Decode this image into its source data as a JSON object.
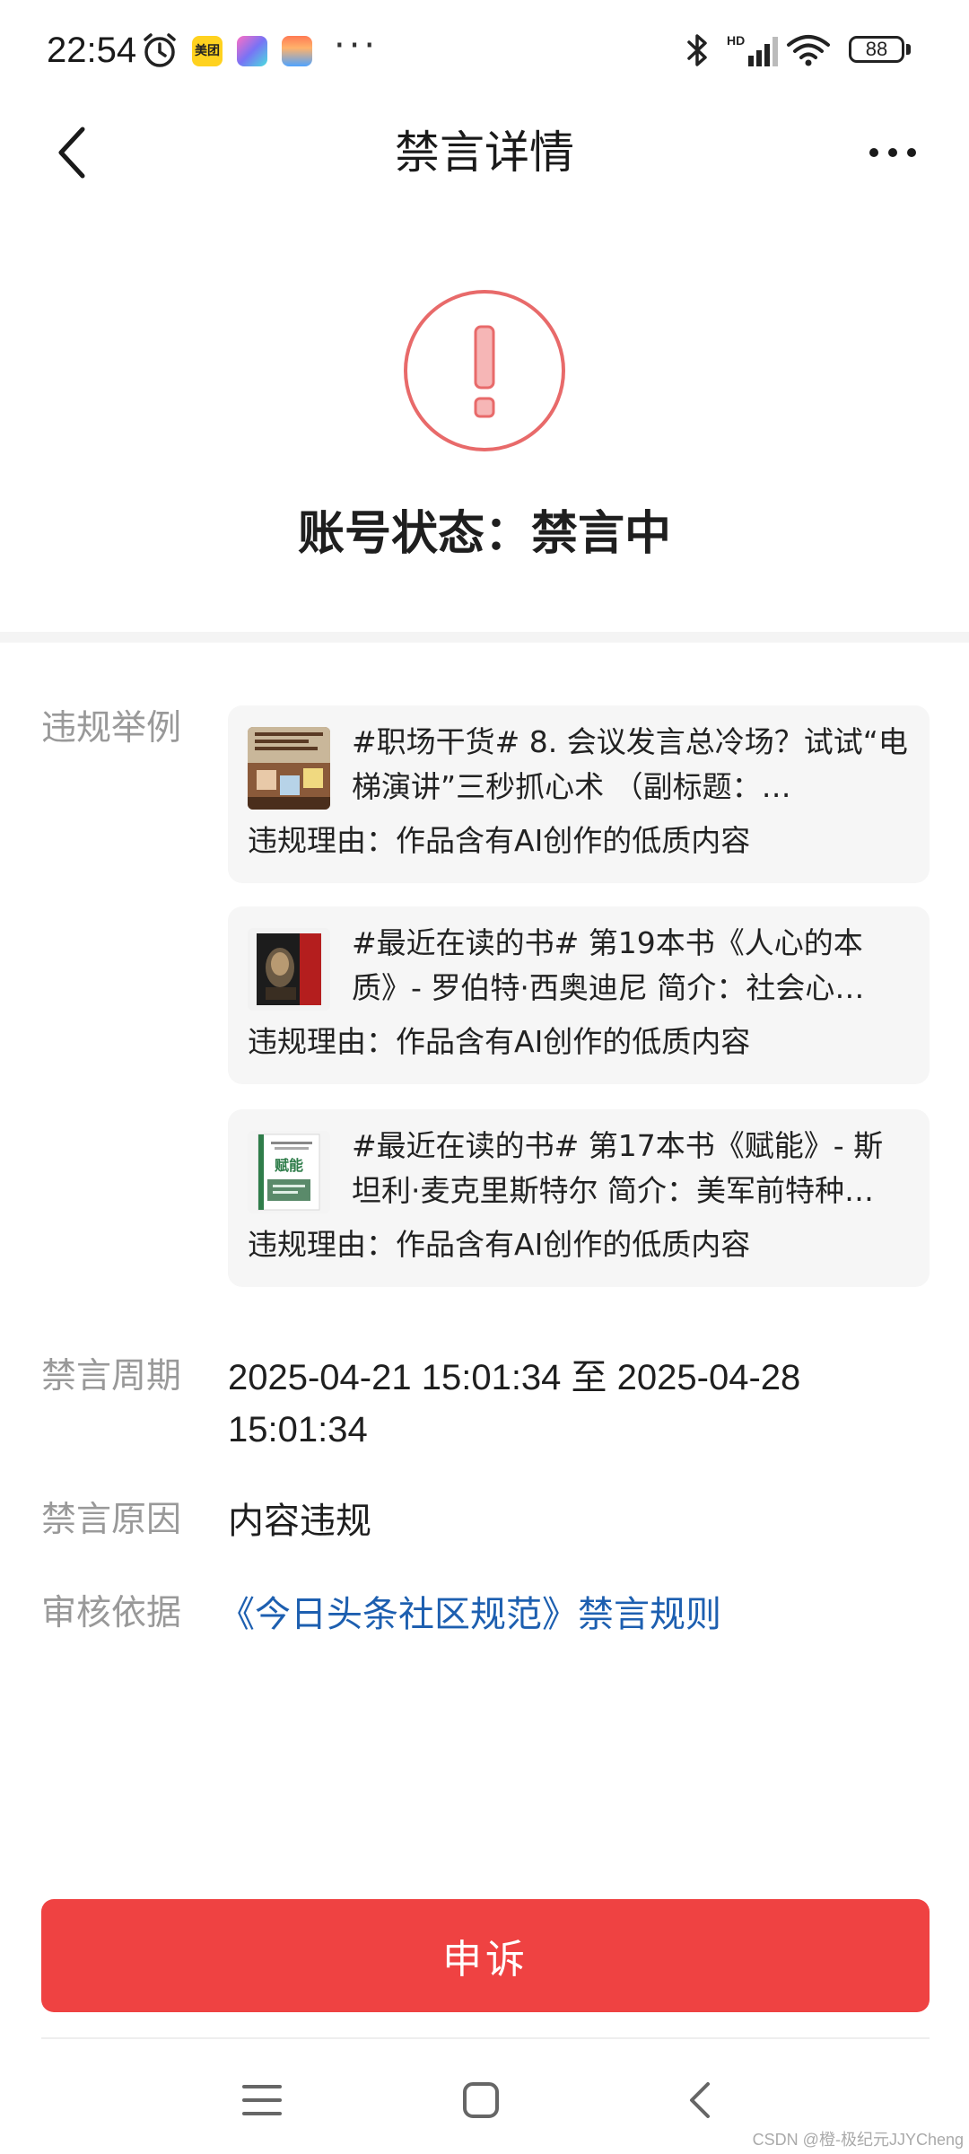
{
  "status_bar": {
    "time": "22:54",
    "meituan_label": "美团",
    "overflow": "···",
    "network_label": "HD",
    "battery": "88",
    "icons": [
      "alarm-icon",
      "meituan-app-icon",
      "shortcut-app-icon",
      "wallet-app-icon",
      "bluetooth-icon",
      "signal-icon",
      "wifi-icon",
      "battery-icon"
    ]
  },
  "nav": {
    "title": "禁言详情",
    "back_icon": "chevron-left-icon",
    "more_icon": "more-horizontal-icon"
  },
  "status": {
    "icon": "exclamation-circle-icon",
    "text": "账号状态：禁言中",
    "accent_color": "#e86a6a"
  },
  "violations": {
    "label": "违规举例",
    "items": [
      {
        "title": "#职场干货# 8. 会议发言总冷场？试试“电梯演讲”三秒抓心术 （副标题：…",
        "reason": "违规理由：作品含有AI创作的低质内容",
        "thumb_icon": "article-thumbnail"
      },
      {
        "title": "#最近在读的书# 第19本书《人心的本质》- 罗伯特·西奥迪尼 简介：社会心…",
        "reason": "违规理由：作品含有AI创作的低质内容",
        "thumb_icon": "book-cover-thumbnail"
      },
      {
        "title": "#最近在读的书# 第17本书《赋能》- 斯坦利·麦克里斯特尔 简介：美军前特种…",
        "reason": "违规理由：作品含有AI创作的低质内容",
        "thumb_icon": "book-cover-thumbnail",
        "thumb_text": "赋能"
      }
    ]
  },
  "ban_period": {
    "label": "禁言周期",
    "value": "2025-04-21 15:01:34 至 2025-04-28 15:01:34"
  },
  "ban_reason": {
    "label": "禁言原因",
    "value": "内容违规"
  },
  "review_basis": {
    "label": "审核依据",
    "value": "《今日头条社区规范》禁言规则",
    "link_color": "#1d5fb0"
  },
  "appeal": {
    "label": "申诉",
    "color": "#ef4242"
  },
  "system_nav": {
    "icons": [
      "menu-icon",
      "home-icon",
      "back-icon"
    ]
  },
  "watermark": "CSDN @橙-极纪元JJYCheng"
}
